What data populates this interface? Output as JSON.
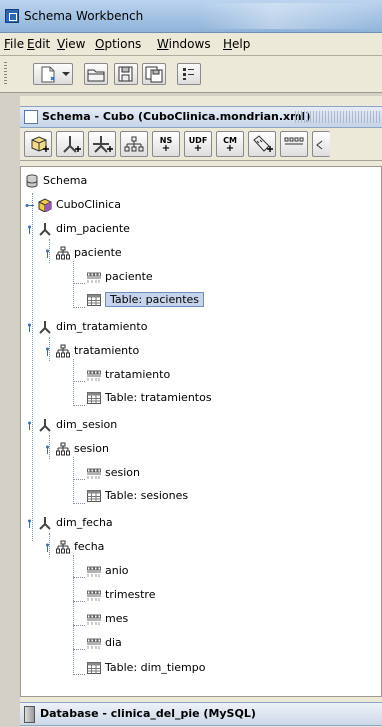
{
  "window": {
    "title": "Schema Workbench"
  },
  "menu": [
    {
      "label": "File",
      "ul": "F",
      "rest": "ile"
    },
    {
      "label": "Edit",
      "ul": "E",
      "rest": "dit"
    },
    {
      "label": "View",
      "ul": "V",
      "rest": "iew"
    },
    {
      "label": "Options",
      "ul": "O",
      "rest": "ptions"
    },
    {
      "label": "Windows",
      "ul": "W",
      "rest": "indows"
    },
    {
      "label": "Help",
      "ul": "H",
      "rest": "elp"
    }
  ],
  "toolbar": {
    "icons": [
      "new-file-icon",
      "open-folder-icon",
      "save-icon",
      "save-as-icon",
      "preferences-icon"
    ]
  },
  "pane": {
    "title": "Schema - Cubo (CuboClinica.mondrian.xml)"
  },
  "schema_toolbar": {
    "buttons": [
      {
        "name": "add-cube-button",
        "icon": "cube-add-icon",
        "text": ""
      },
      {
        "name": "add-dimension-button",
        "icon": "dimension-add-icon",
        "text": ""
      },
      {
        "name": "add-dimension-usage-button",
        "icon": "dimension-usage-icon",
        "text": ""
      },
      {
        "name": "add-hierarchy-button",
        "icon": "hierarchy-add-icon",
        "text": ""
      },
      {
        "name": "add-named-set-button",
        "icon": "named-set-icon",
        "text": "NS"
      },
      {
        "name": "add-udf-button",
        "icon": "udf-icon",
        "text": "UDF"
      },
      {
        "name": "add-calculated-member-button",
        "icon": "calc-member-icon",
        "text": "CM"
      },
      {
        "name": "add-measure-button",
        "icon": "measure-add-icon",
        "text": ""
      },
      {
        "name": "add-level-button",
        "icon": "level-add-icon",
        "text": ""
      }
    ]
  },
  "tree": {
    "root": "Schema",
    "cube": "CuboClinica",
    "dimensions": [
      {
        "name": "dim_paciente",
        "hierarchy": "paciente",
        "levels": [
          "paciente"
        ],
        "table": "Table: pacientes"
      },
      {
        "name": "dim_tratamiento",
        "hierarchy": "tratamiento",
        "levels": [
          "tratamiento"
        ],
        "table": "Table: tratamientos"
      },
      {
        "name": "dim_sesion",
        "hierarchy": "sesion",
        "levels": [
          "sesion"
        ],
        "table": "Table: sesiones"
      },
      {
        "name": "dim_fecha",
        "hierarchy": "fecha",
        "levels": [
          "anio",
          "trimestre",
          "mes",
          "dia"
        ],
        "table": "Table: dim_tiempo"
      }
    ],
    "selected": "Table: pacientes"
  },
  "status": {
    "database": "Database - clinica_del_pie (MySQL)"
  },
  "colors": {
    "selection": "#c5d4ea",
    "titlebar": "#8fb3da"
  }
}
